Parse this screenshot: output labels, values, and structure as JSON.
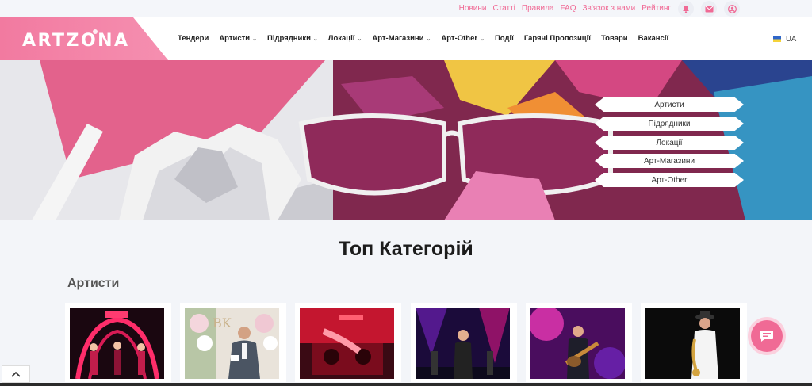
{
  "top_links": [
    "Новини",
    "Статті",
    "Правила",
    "FAQ",
    "Зв'язок з нами",
    "Рейтинг"
  ],
  "top_icons": [
    "bell-icon",
    "mail-icon",
    "user-icon"
  ],
  "brand": {
    "logo": "ARTZONA",
    "accent": "#f06a95"
  },
  "nav": [
    {
      "label": "Тендери",
      "dropdown": false
    },
    {
      "label": "Артисти",
      "dropdown": true
    },
    {
      "label": "Підрядники",
      "dropdown": true
    },
    {
      "label": "Локації",
      "dropdown": true
    },
    {
      "label": "Арт-Магазини",
      "dropdown": true
    },
    {
      "label": "Арт-Other",
      "dropdown": true
    },
    {
      "label": "Події",
      "dropdown": false
    },
    {
      "label": "Гарячі Пропозиції",
      "dropdown": false
    },
    {
      "label": "Товари",
      "dropdown": false
    },
    {
      "label": "Вакансії",
      "dropdown": false
    }
  ],
  "language": "UA",
  "hero_links": [
    "Артисти",
    "Підрядники",
    "Локації",
    "Арт-Магазини",
    "Арт-Other"
  ],
  "section_title": "Топ Категорій",
  "category": {
    "title": "Артисти",
    "cards": [
      "dance-show",
      "host",
      "dj",
      "singer",
      "guitarist",
      "saxophonist"
    ]
  }
}
